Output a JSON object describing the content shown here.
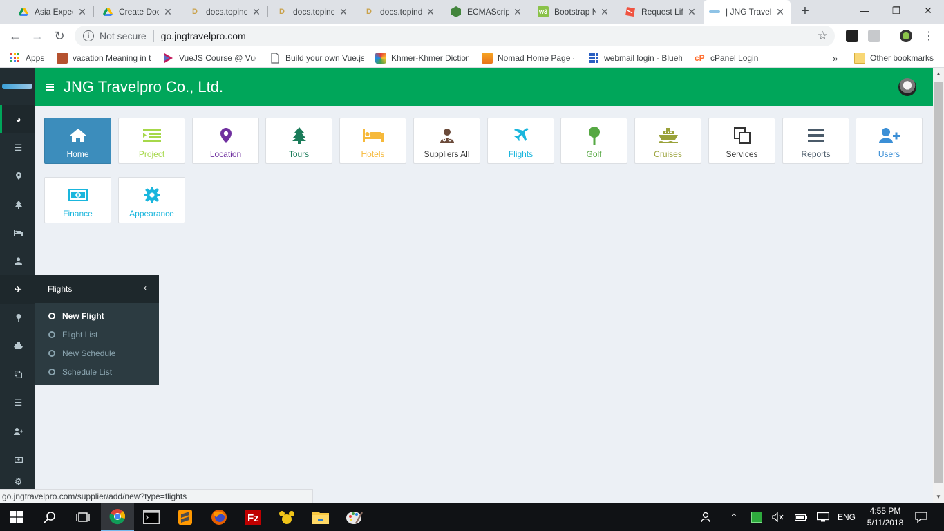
{
  "browser": {
    "tabs": [
      {
        "label": "Asia Expedi",
        "icon": "google-drive-icon",
        "active": false
      },
      {
        "label": "Create Doc",
        "icon": "google-drive-icon",
        "active": false
      },
      {
        "label": "docs.topind",
        "icon": "docs-d-icon",
        "active": false
      },
      {
        "label": "docs.topind",
        "icon": "docs-d-icon",
        "active": false
      },
      {
        "label": "docs.topind",
        "icon": "docs-d-icon",
        "active": false
      },
      {
        "label": "ECMAScript",
        "icon": "hexagon-icon",
        "active": false
      },
      {
        "label": "Bootstrap N",
        "icon": "w3-icon",
        "active": false
      },
      {
        "label": "Request Life",
        "icon": "laravel-icon",
        "active": false
      },
      {
        "label": "| JNG Travel",
        "icon": "jng-icon",
        "active": true
      }
    ],
    "security_label": "Not secure",
    "url": "go.jngtravelpro.com",
    "bookmarks": [
      {
        "label": "Apps",
        "icon": "apps-grid-icon"
      },
      {
        "label": "vacation Meaning in t",
        "icon": "cambridge-icon"
      },
      {
        "label": "VueJS Course @ Vue",
        "icon": "vue-play-icon"
      },
      {
        "label": "Build your own Vue.js",
        "icon": "page-icon"
      },
      {
        "label": "Khmer-Khmer Diction",
        "icon": "khmer-icon"
      },
      {
        "label": "Nomad Home Page -",
        "icon": "nomad-icon"
      },
      {
        "label": "webmail login - Blueh",
        "icon": "bluehost-grid-icon"
      },
      {
        "label": "cPanel Login",
        "icon": "cpanel-icon"
      }
    ],
    "other_bookmarks": "Other bookmarks",
    "status_url": "go.jngtravelpro.com/supplier/add/new?type=flights"
  },
  "app": {
    "title": "JNG Travelpro Co., Ltd.",
    "tiles": [
      {
        "label": "Home",
        "icon": "home-icon",
        "color": "#ffffff",
        "active": true
      },
      {
        "label": "Project",
        "icon": "project-list-icon",
        "color": "#a6d84a",
        "active": false
      },
      {
        "label": "Location",
        "icon": "map-pin-icon",
        "color": "#6f2f9f",
        "active": false
      },
      {
        "label": "Tours",
        "icon": "tree-icon",
        "color": "#1b7c5a",
        "active": false
      },
      {
        "label": "Hotels",
        "icon": "bed-icon",
        "color": "#f6b93b",
        "active": false
      },
      {
        "label": "Suppliers All",
        "icon": "supplier-icon",
        "color": "#6b4a3a",
        "active": false
      },
      {
        "label": "Flights",
        "icon": "plane-icon",
        "color": "#1ab6dd",
        "active": false
      },
      {
        "label": "Golf",
        "icon": "golf-icon",
        "color": "#56a843",
        "active": false
      },
      {
        "label": "Cruises",
        "icon": "ship-icon",
        "color": "#9aa23a",
        "active": false
      },
      {
        "label": "Services",
        "icon": "clone-icon",
        "color": "#333333",
        "active": false
      },
      {
        "label": "Reports",
        "icon": "bars-icon",
        "color": "#4b5b6a",
        "active": false
      },
      {
        "label": "Users",
        "icon": "user-plus-icon",
        "color": "#3b8fd6",
        "active": false
      },
      {
        "label": "Finance",
        "icon": "money-icon",
        "color": "#1ab6dd",
        "active": false
      },
      {
        "label": "Appearance",
        "icon": "cog-icon",
        "color": "#1ab6dd",
        "active": false
      }
    ],
    "sidebar_icons": [
      "dashboard-icon",
      "list-icon",
      "map-pin-icon",
      "tree-icon",
      "bed-icon",
      "supplier-icon",
      "plane-icon",
      "golf-icon",
      "ship-icon",
      "clone-icon",
      "bars-icon",
      "user-plus-icon",
      "money-icon",
      "cog-icon"
    ],
    "flyout": {
      "title": "Flights",
      "items": [
        {
          "label": "New Flight",
          "active": true
        },
        {
          "label": "Flight List",
          "active": false
        },
        {
          "label": "New Schedule",
          "active": false
        },
        {
          "label": "Schedule List",
          "active": false
        }
      ]
    }
  },
  "taskbar": {
    "apps": [
      "windows-start-icon",
      "search-icon",
      "task-view-icon",
      "chrome-icon",
      "terminal-icon",
      "sublime-icon",
      "firefox-icon",
      "filezilla-icon",
      "paw-icon",
      "file-explorer-icon",
      "paint-icon"
    ],
    "language": "ENG",
    "time": "4:55 PM",
    "date": "5/11/2018"
  }
}
